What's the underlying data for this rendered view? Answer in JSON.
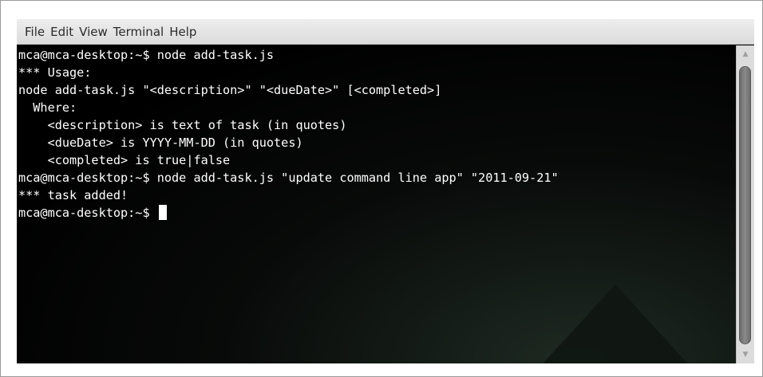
{
  "menu": {
    "items": [
      "File",
      "Edit",
      "View",
      "Terminal",
      "Help"
    ]
  },
  "terminal": {
    "lines": [
      "mca@mca-desktop:~$ node add-task.js",
      "*** Usage:",
      "node add-task.js \"<description>\" \"<dueDate>\" [<completed>]",
      "  Where:",
      "    <description> is text of task (in quotes)",
      "    <dueDate> is YYYY-MM-DD (in quotes)",
      "    <completed> is true|false",
      "mca@mca-desktop:~$ node add-task.js \"update command line app\" \"2011-09-21\"",
      "*** task added!"
    ],
    "prompt": "mca@mca-desktop:~$ "
  },
  "icons": {
    "scroll_up": "scroll-up-arrow-icon",
    "scroll_down": "scroll-down-arrow-icon"
  },
  "colors": {
    "terminal_bg": "#000000",
    "terminal_fg": "#ffffff",
    "menubar_bg": "#e6e6e6"
  }
}
